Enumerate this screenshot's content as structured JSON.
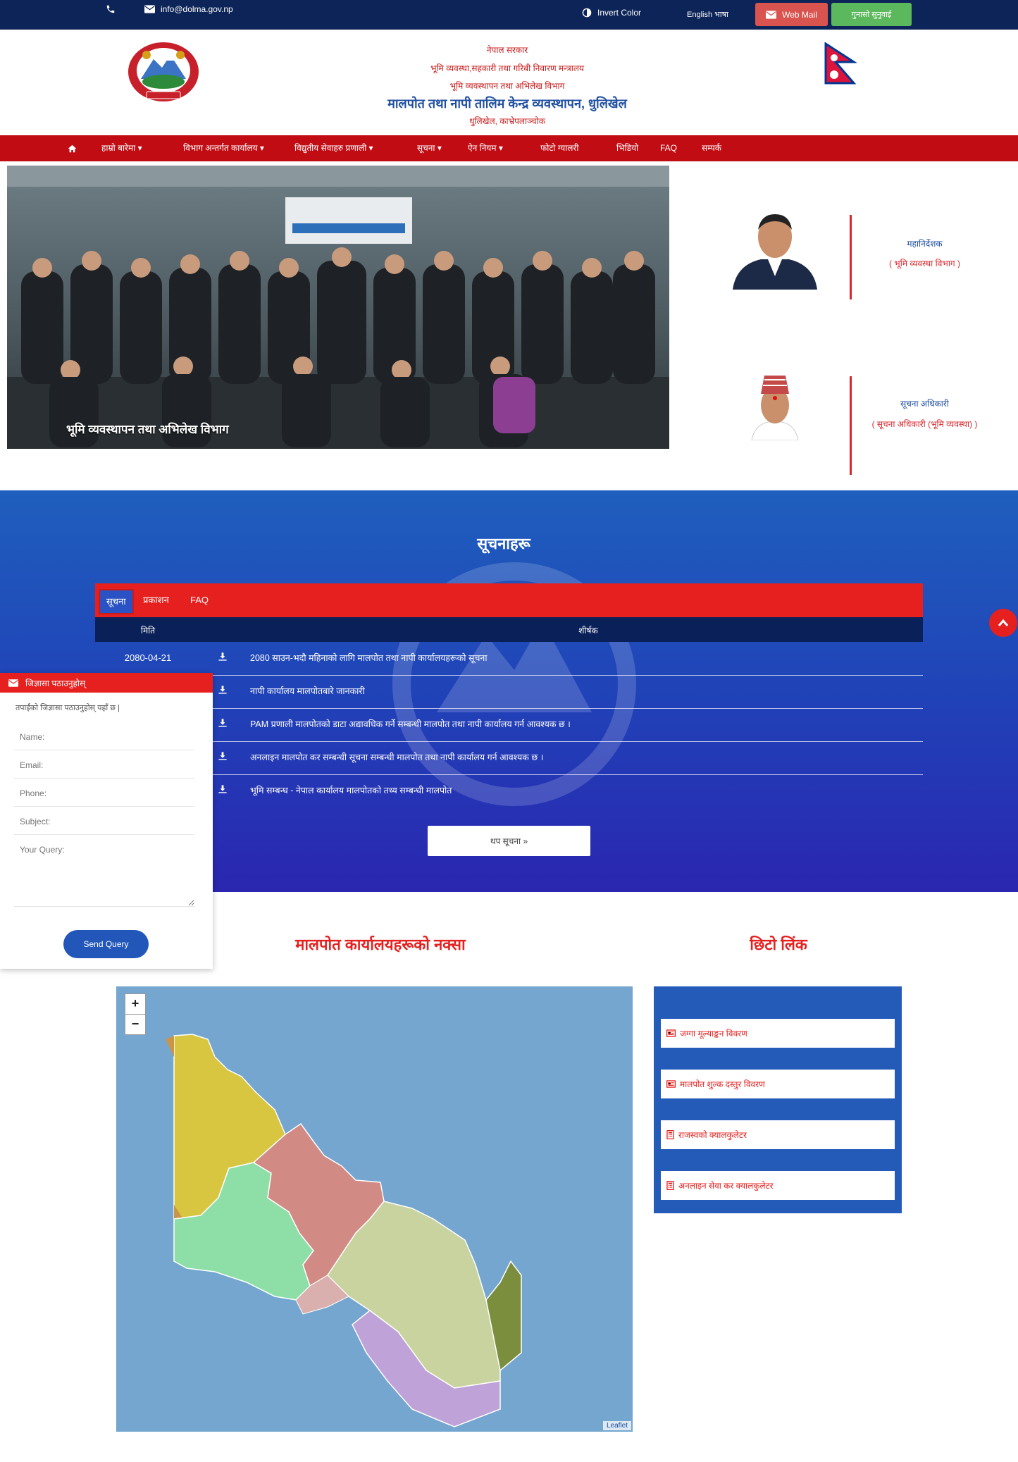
{
  "topbar": {
    "email": "info@dolma.gov.np",
    "invert_color": "Invert Color",
    "english_link": "English भाषा",
    "webmail": "Web Mail",
    "grievance": "गुनासो सुनुवाई"
  },
  "header": {
    "line1": "नेपाल सरकार",
    "line2": "भूमि व्यवस्था,सहकारी तथा गरिबी निवारण मन्त्रालय",
    "line3": "भूमि व्यवस्थापन तथा अभिलेख विभाग",
    "main_title": "मालपोत तथा नापी तालिम केन्द्र व्यवस्थापन, धुलिखेल",
    "location": "धुलिखेल, काभ्रेपलाञ्चोक"
  },
  "nav": {
    "items": [
      {
        "label": "हाम्रो बारेमा"
      },
      {
        "label": "विभाग अन्तर्गत कार्यालय"
      },
      {
        "label": "विद्युतीय सेवाहरु प्रणाली"
      },
      {
        "label": "सूचना"
      },
      {
        "label": "ऐन नियम"
      },
      {
        "label": "फोटो ग्यालरी"
      },
      {
        "label": "भिडियो"
      },
      {
        "label": "FAQ"
      },
      {
        "label": "सम्पर्क"
      }
    ]
  },
  "slider": {
    "caption": "भूमि व्यवस्थापन तथा अभिलेख विभाग"
  },
  "officials": [
    {
      "name": "महानिर्देशक",
      "role": "( भूमि व्यवस्था विभाग )"
    },
    {
      "name": "सूचना अधिकारी",
      "role": "( सूचना अधिकारी (भूमि व्यवस्था) )"
    }
  ],
  "notices": {
    "title": "सूचनाहरू",
    "tabs": [
      "सूचना",
      "प्रकाशन",
      "FAQ"
    ],
    "col_date": "मिति",
    "col_title": "शीर्षक",
    "rows": [
      {
        "date": "2080-04-21",
        "title": "2080 साउन-भदौ महिनाको लागि मालपोत तथा नापी कार्यालयहरूको सूचना"
      },
      {
        "date": "",
        "title": "नापी कार्यालय मालपोतबारे जानकारी"
      },
      {
        "date": "",
        "title": "PAM प्रणाली मालपोतको डाटा अद्यावधिक गर्ने सम्बन्धी मालपोत तथा नापी कार्यालय गर्न आवश्यक छ ।"
      },
      {
        "date": "",
        "title": "अनलाइन मालपोत कर सम्बन्धी सूचना सम्बन्धी मालपोत तथा नापी कार्यालय गर्न आवश्यक छ ।"
      },
      {
        "date": "",
        "title": "भूमि सम्बन्ध - नेपाल कार्यालय मालपोतको तथ्य सम्बन्धी मालपोत"
      }
    ],
    "more": "थप सूचना"
  },
  "query": {
    "title": "जिज्ञासा पठाउनुहोस्",
    "intro": "तपाईंको जिज्ञासा पठाउनुहोस् यहाँ छ |",
    "name_placeholder": "Name:",
    "email_placeholder": "Email:",
    "phone_placeholder": "Phone:",
    "subject_placeholder": "Subject:",
    "query_placeholder": "Your Query:",
    "send": "Send Query"
  },
  "map_section": {
    "title": "मालपोत कार्यालयहरूको नक्सा",
    "zoom_in": "+",
    "zoom_out": "−",
    "attribution": "Leaflet"
  },
  "links_section": {
    "title": "छिटो लिंक",
    "items": [
      {
        "label": "जग्गा मूल्याङ्कन विवरण",
        "icon": "newspaper-icon"
      },
      {
        "label": "मालपोत शुल्क दस्तुर विवरण",
        "icon": "newspaper-icon"
      },
      {
        "label": "राजस्वको क्यालकुलेटर",
        "icon": "calculator-icon"
      },
      {
        "label": "अनलाइन सेवा कर क्यालकुलेटर",
        "icon": "calculator-icon"
      }
    ]
  }
}
